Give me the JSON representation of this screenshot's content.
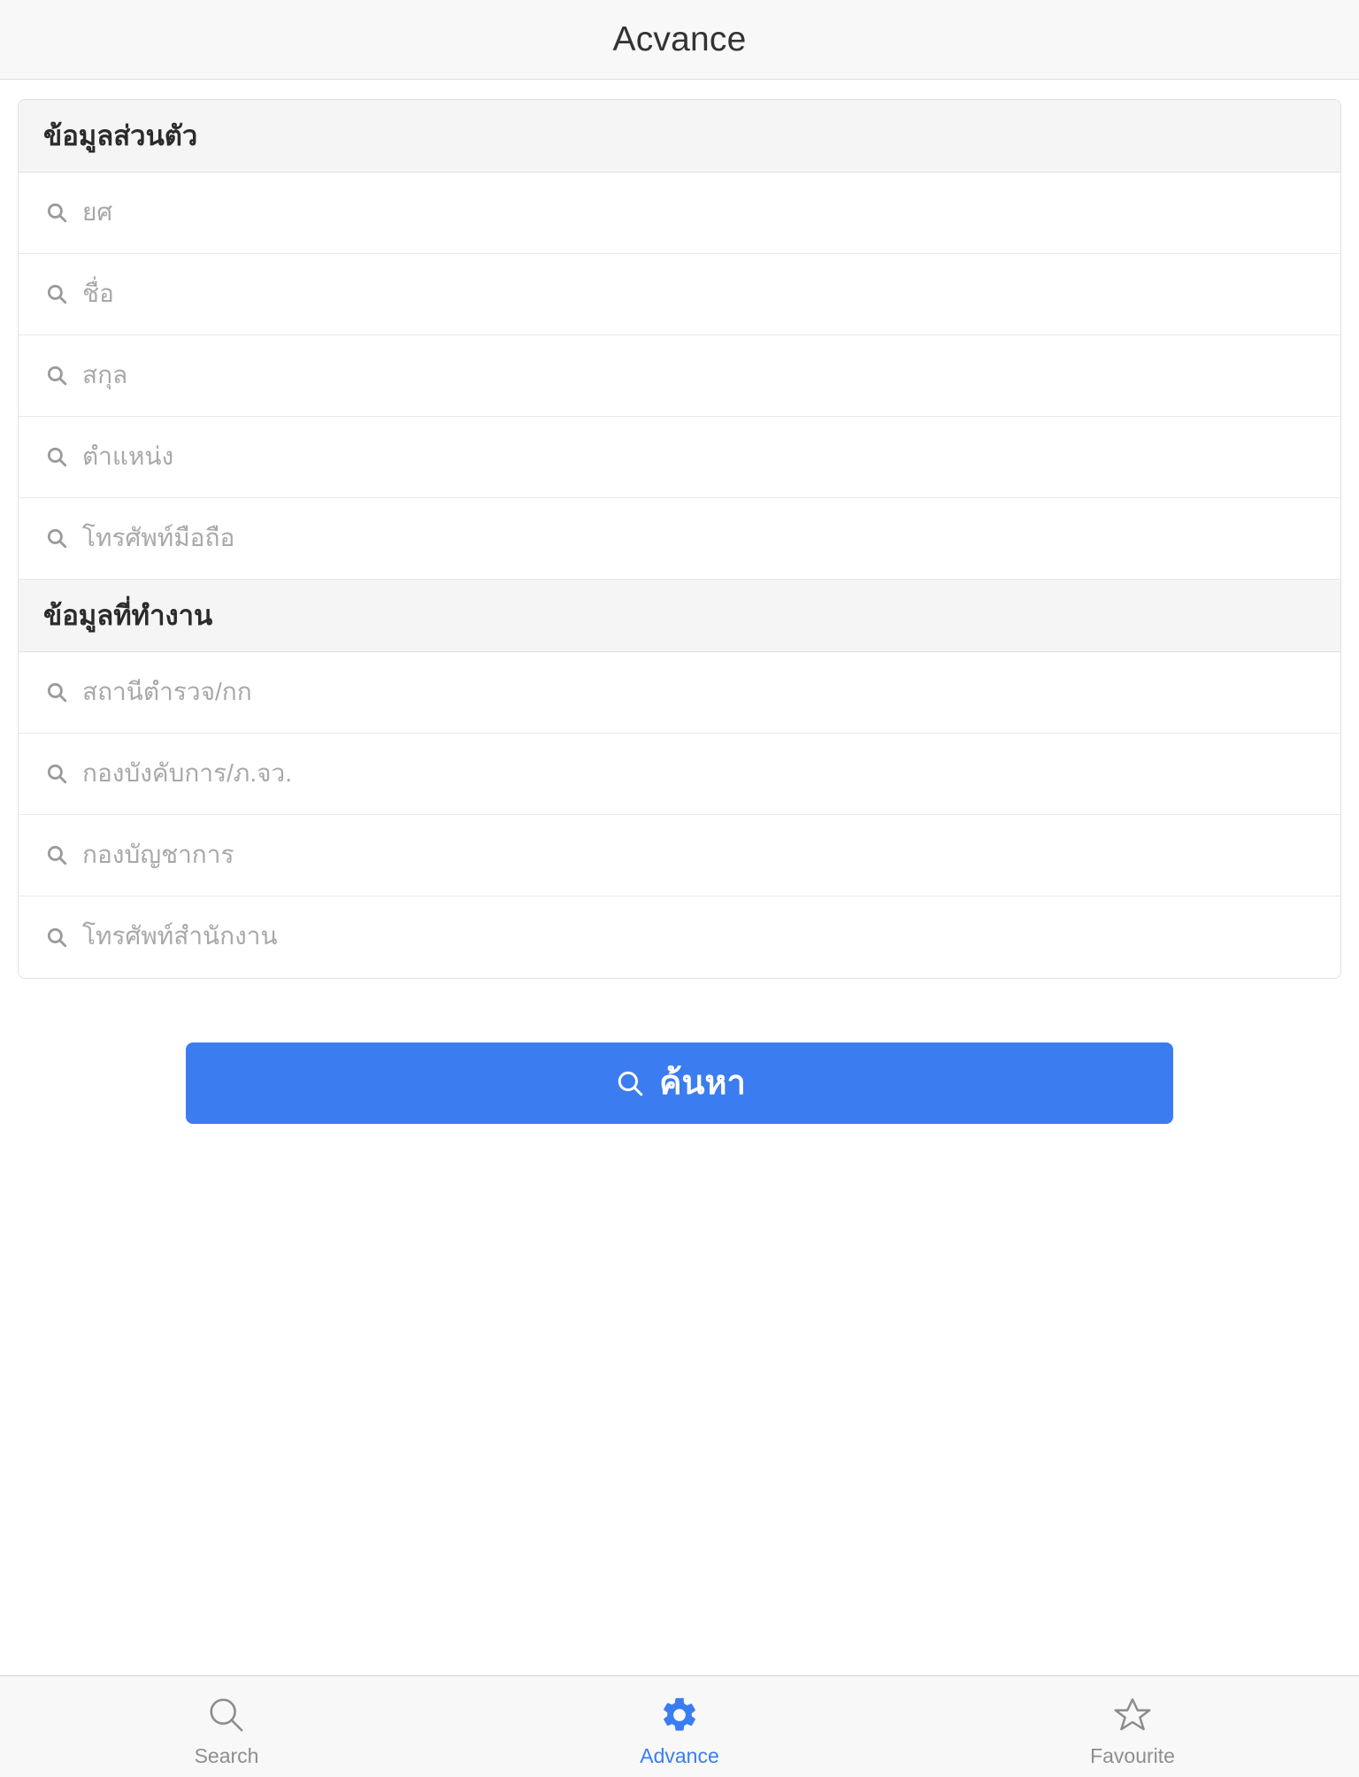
{
  "navbar": {
    "title": "Acvance"
  },
  "form": {
    "sections": [
      {
        "header": "ข้อมูลส่วนตัว",
        "fields": [
          {
            "placeholder": "ยศ",
            "value": "",
            "icon": "search-icon"
          },
          {
            "placeholder": "ชื่อ",
            "value": "",
            "icon": "search-icon"
          },
          {
            "placeholder": "สกุล",
            "value": "",
            "icon": "search-icon"
          },
          {
            "placeholder": "ตำแหน่ง",
            "value": "",
            "icon": "search-icon"
          },
          {
            "placeholder": "โทรศัพท์มือถือ",
            "value": "",
            "icon": "search-icon"
          }
        ]
      },
      {
        "header": "ข้อมูลที่ทำงาน",
        "fields": [
          {
            "placeholder": "สถานีตำรวจ/กก",
            "value": "",
            "icon": "search-icon"
          },
          {
            "placeholder": "กองบังคับการ/ภ.จว.",
            "value": "",
            "icon": "search-icon"
          },
          {
            "placeholder": "กองบัญชาการ",
            "value": "",
            "icon": "search-icon"
          },
          {
            "placeholder": "โทรศัพท์สำนักงาน",
            "value": "",
            "icon": "search-icon"
          }
        ]
      }
    ]
  },
  "submit": {
    "label": "ค้นหา",
    "icon": "search-icon",
    "color": "#3b7df0"
  },
  "tabbar": {
    "active_index": 1,
    "active_color": "#3b7df0",
    "inactive_color": "#8e8e8e",
    "tabs": [
      {
        "label": "Search",
        "icon": "magnifier-icon"
      },
      {
        "label": "Advance",
        "icon": "gear-icon"
      },
      {
        "label": "Favourite",
        "icon": "star-icon"
      }
    ]
  }
}
